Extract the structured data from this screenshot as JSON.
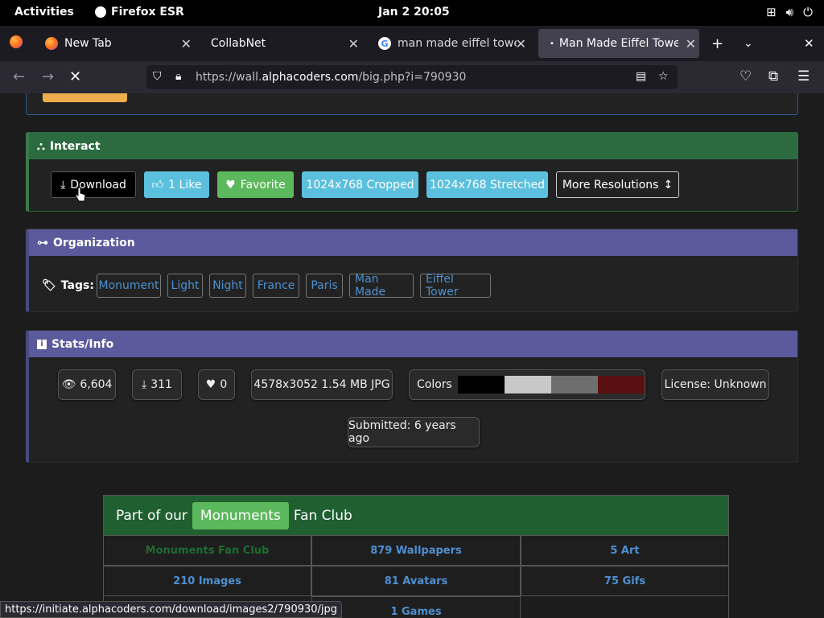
{
  "topbar": {
    "activities": "Activities",
    "app_name": "Firefox ESR",
    "clock": "Jan 2  20:05"
  },
  "tabs": [
    {
      "label": "New Tab",
      "icon": "firefox-icon"
    },
    {
      "label": "CollabNet",
      "icon": ""
    },
    {
      "label": "man made eiffel tower",
      "icon": "google-icon"
    },
    {
      "label": "Man Made Eiffel Tower",
      "icon": "loading-dot",
      "active": true
    }
  ],
  "nav": {
    "url_prefix": "https://wall.",
    "url_domain": "alphacoders.com",
    "url_suffix": "/big.php?i=790930"
  },
  "interact": {
    "title": "Interact",
    "buttons": {
      "download": "Download",
      "like": "1 Like",
      "favorite": "Favorite",
      "cropped": "1024x768 Cropped",
      "stretched": "1024x768 Stretched",
      "more": "More Resolutions"
    }
  },
  "organization": {
    "title": "Organization",
    "tags_label": "Tags:",
    "tags": [
      "Monument",
      "Light",
      "Night",
      "France",
      "Paris",
      "Man Made",
      "Eiffel Tower"
    ]
  },
  "stats": {
    "title": "Stats/Info",
    "views": "6,604",
    "downloads": "311",
    "favorites": "0",
    "file_info": "4578x3052 1.54 MB JPG",
    "colors_label": "Colors",
    "colors": [
      "#000000",
      "#c8c8c8",
      "#6e6e6e",
      "#5a1010"
    ],
    "license": "License: Unknown",
    "submitted": "Submitted: 6 years ago"
  },
  "fanclub": {
    "prefix": "Part of our",
    "badge": "Monuments",
    "suffix": "Fan Club",
    "cells": [
      "Monuments Fan Club",
      "879 Wallpapers",
      "5 Art",
      "210 Images",
      "81 Avatars",
      "75 Gifs",
      "1 Games"
    ]
  },
  "statusbar": "https://initiate.alphacoders.com/download/images2/790930/jpg"
}
